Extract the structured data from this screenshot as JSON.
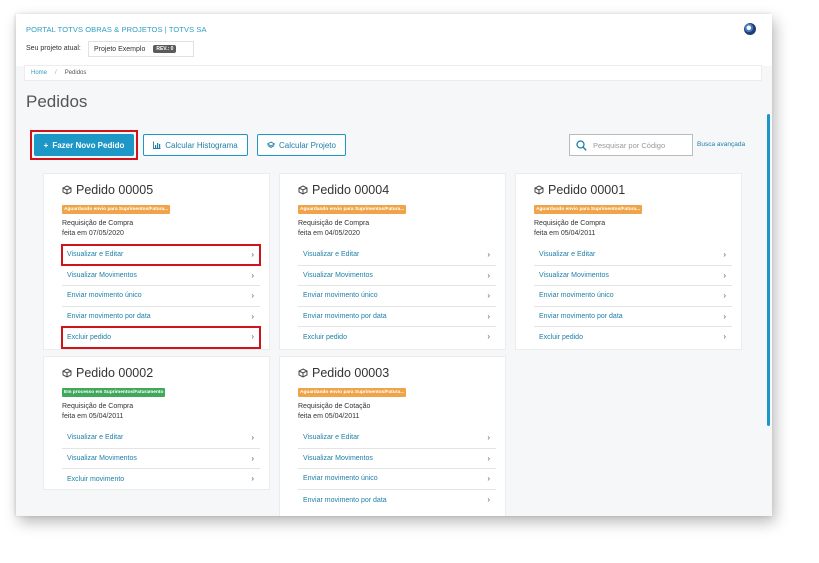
{
  "header": {
    "portal_title": "PORTAL TOTVS OBRAS & PROJETOS | TOTVS SA",
    "project_label": "Seu projeto atual:",
    "project_name": "Projeto Exemplo",
    "revision": "REV.: 0"
  },
  "breadcrumb": {
    "home": "Home",
    "separator": "/",
    "current": "Pedidos"
  },
  "page_title": "Pedidos",
  "toolbar": {
    "new_order": "Fazer Novo Pedido",
    "new_order_icon": "+",
    "histogram": "Calcular Histograma",
    "project": "Calcular Projeto",
    "search_placeholder": "Pesquisar por Código",
    "advanced_search": "Busca avançada"
  },
  "colors": {
    "accent": "#1d98c6",
    "highlight": "#d0121b",
    "pending": "#f0a44a",
    "processing": "#40a85a"
  },
  "orders": [
    {
      "title": "Pedido 00005",
      "status": "Aguardando envio para Suprimentos/Fatura...",
      "type": "Requisição de Compra",
      "date": "feita em 07/05/2020",
      "actions": [
        "Visualizar e Editar",
        "Visualizar Movimentos",
        "Enviar movimento único",
        "Enviar movimento por data",
        "Excluir pedido"
      ]
    },
    {
      "title": "Pedido 00004",
      "status": "Aguardando envio para Suprimentos/Fatura...",
      "type": "Requisição de Compra",
      "date": "feita em 04/05/2020",
      "actions": [
        "Visualizar e Editar",
        "Visualizar Movimentos",
        "Enviar movimento único",
        "Enviar movimento por data",
        "Excluir pedido"
      ]
    },
    {
      "title": "Pedido 00001",
      "status": "Aguardando envio para Suprimentos/Fatura...",
      "type": "Requisição de Compra",
      "date": "feita em 05/04/2011",
      "actions": [
        "Visualizar e Editar",
        "Visualizar Movimentos",
        "Enviar movimento único",
        "Enviar movimento por data",
        "Excluir pedido"
      ]
    },
    {
      "title": "Pedido 00002",
      "status": "Em processo em Suprimentos/Faturamento",
      "type": "Requisição de Compra",
      "date": "feita em 05/04/2011",
      "actions": [
        "Visualizar e Editar",
        "Visualizar Movimentos",
        "Excluir movimento"
      ]
    },
    {
      "title": "Pedido 00003",
      "status": "Aguardando envio para Suprimentos/Fatura...",
      "type": "Requisição de Cotação",
      "date": "feita em 05/04/2011",
      "actions": [
        "Visualizar e Editar",
        "Visualizar Movimentos",
        "Enviar movimento único",
        "Enviar movimento por data"
      ]
    }
  ]
}
